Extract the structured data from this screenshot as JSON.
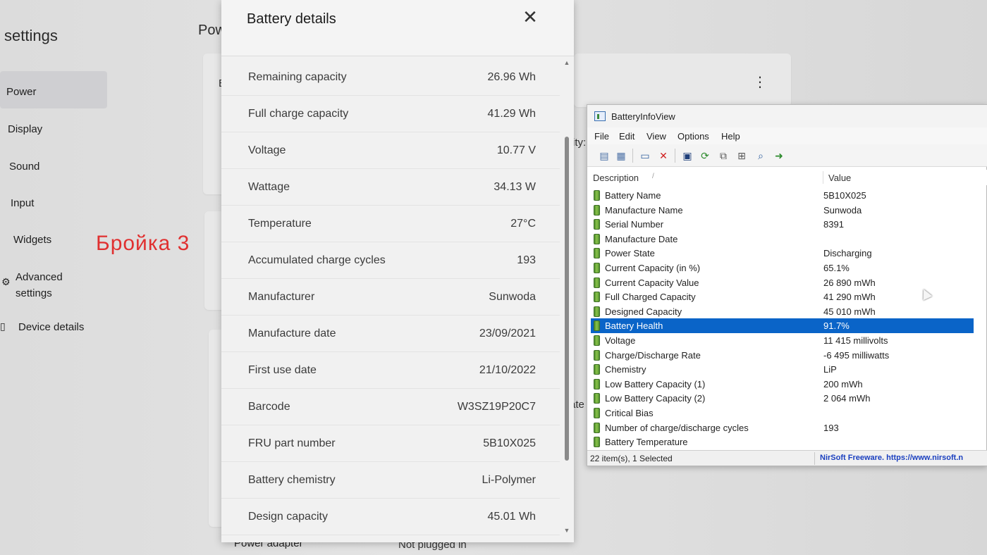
{
  "settings": {
    "title": "settings",
    "heading": "Pow",
    "nav": [
      {
        "label": "Power"
      },
      {
        "label": "Display"
      },
      {
        "label": "Sound"
      },
      {
        "label": "Input"
      },
      {
        "label": "Widgets"
      },
      {
        "label": "Advanced settings"
      },
      {
        "label": "Device details"
      }
    ],
    "overlay_text": "Бройка 3",
    "power_adapter_label": "Power adapter",
    "power_adapter_value": "Not plugged in"
  },
  "battery_dialog": {
    "title": "Battery details",
    "rows": [
      {
        "label": "Remaining capacity",
        "value": "26.96 Wh"
      },
      {
        "label": "Full charge capacity",
        "value": "41.29 Wh"
      },
      {
        "label": "Voltage",
        "value": "10.77 V"
      },
      {
        "label": "Wattage",
        "value": "34.13 W"
      },
      {
        "label": "Temperature",
        "value": "27°C"
      },
      {
        "label": "Accumulated charge cycles",
        "value": "193"
      },
      {
        "label": "Manufacturer",
        "value": "Sunwoda"
      },
      {
        "label": "Manufacture date",
        "value": "23/09/2021"
      },
      {
        "label": "First use date",
        "value": "21/10/2022"
      },
      {
        "label": "Barcode",
        "value": "W3SZ19P20C7"
      },
      {
        "label": "FRU part number",
        "value": "5B10X025"
      },
      {
        "label": "Battery chemistry",
        "value": "Li-Polymer"
      },
      {
        "label": "Design capacity",
        "value": "45.01 Wh"
      }
    ]
  },
  "battery_info_view": {
    "title": "BatteryInfoView",
    "menu": [
      "File",
      "Edit",
      "View",
      "Options",
      "Help"
    ],
    "columns": {
      "description": "Description",
      "value": "Value"
    },
    "rows": [
      {
        "description": "Battery Name",
        "value": "5B10X025"
      },
      {
        "description": "Manufacture Name",
        "value": "Sunwoda"
      },
      {
        "description": "Serial Number",
        "value": "8391"
      },
      {
        "description": "Manufacture Date",
        "value": ""
      },
      {
        "description": "Power State",
        "value": "Discharging"
      },
      {
        "description": "Current Capacity (in %)",
        "value": "65.1%"
      },
      {
        "description": "Current Capacity Value",
        "value": "26 890 mWh"
      },
      {
        "description": "Full Charged Capacity",
        "value": "41 290 mWh"
      },
      {
        "description": "Designed Capacity",
        "value": "45 010 mWh"
      },
      {
        "description": "Battery Health",
        "value": "91.7%"
      },
      {
        "description": "Voltage",
        "value": "11 415 millivolts"
      },
      {
        "description": "Charge/Discharge Rate",
        "value": "-6 495 milliwatts"
      },
      {
        "description": "Chemistry",
        "value": "LiP"
      },
      {
        "description": "Low Battery Capacity (1)",
        "value": "200 mWh"
      },
      {
        "description": "Low Battery Capacity (2)",
        "value": "2 064 mWh"
      },
      {
        "description": "Critical Bias",
        "value": ""
      },
      {
        "description": "Number of charge/discharge cycles",
        "value": "193"
      },
      {
        "description": "Battery Temperature",
        "value": ""
      }
    ],
    "selected_row": "Battery Health",
    "status_left": "22 item(s), 1 Selected",
    "status_right": "NirSoft Freeware. https://www.nirsoft.n"
  }
}
